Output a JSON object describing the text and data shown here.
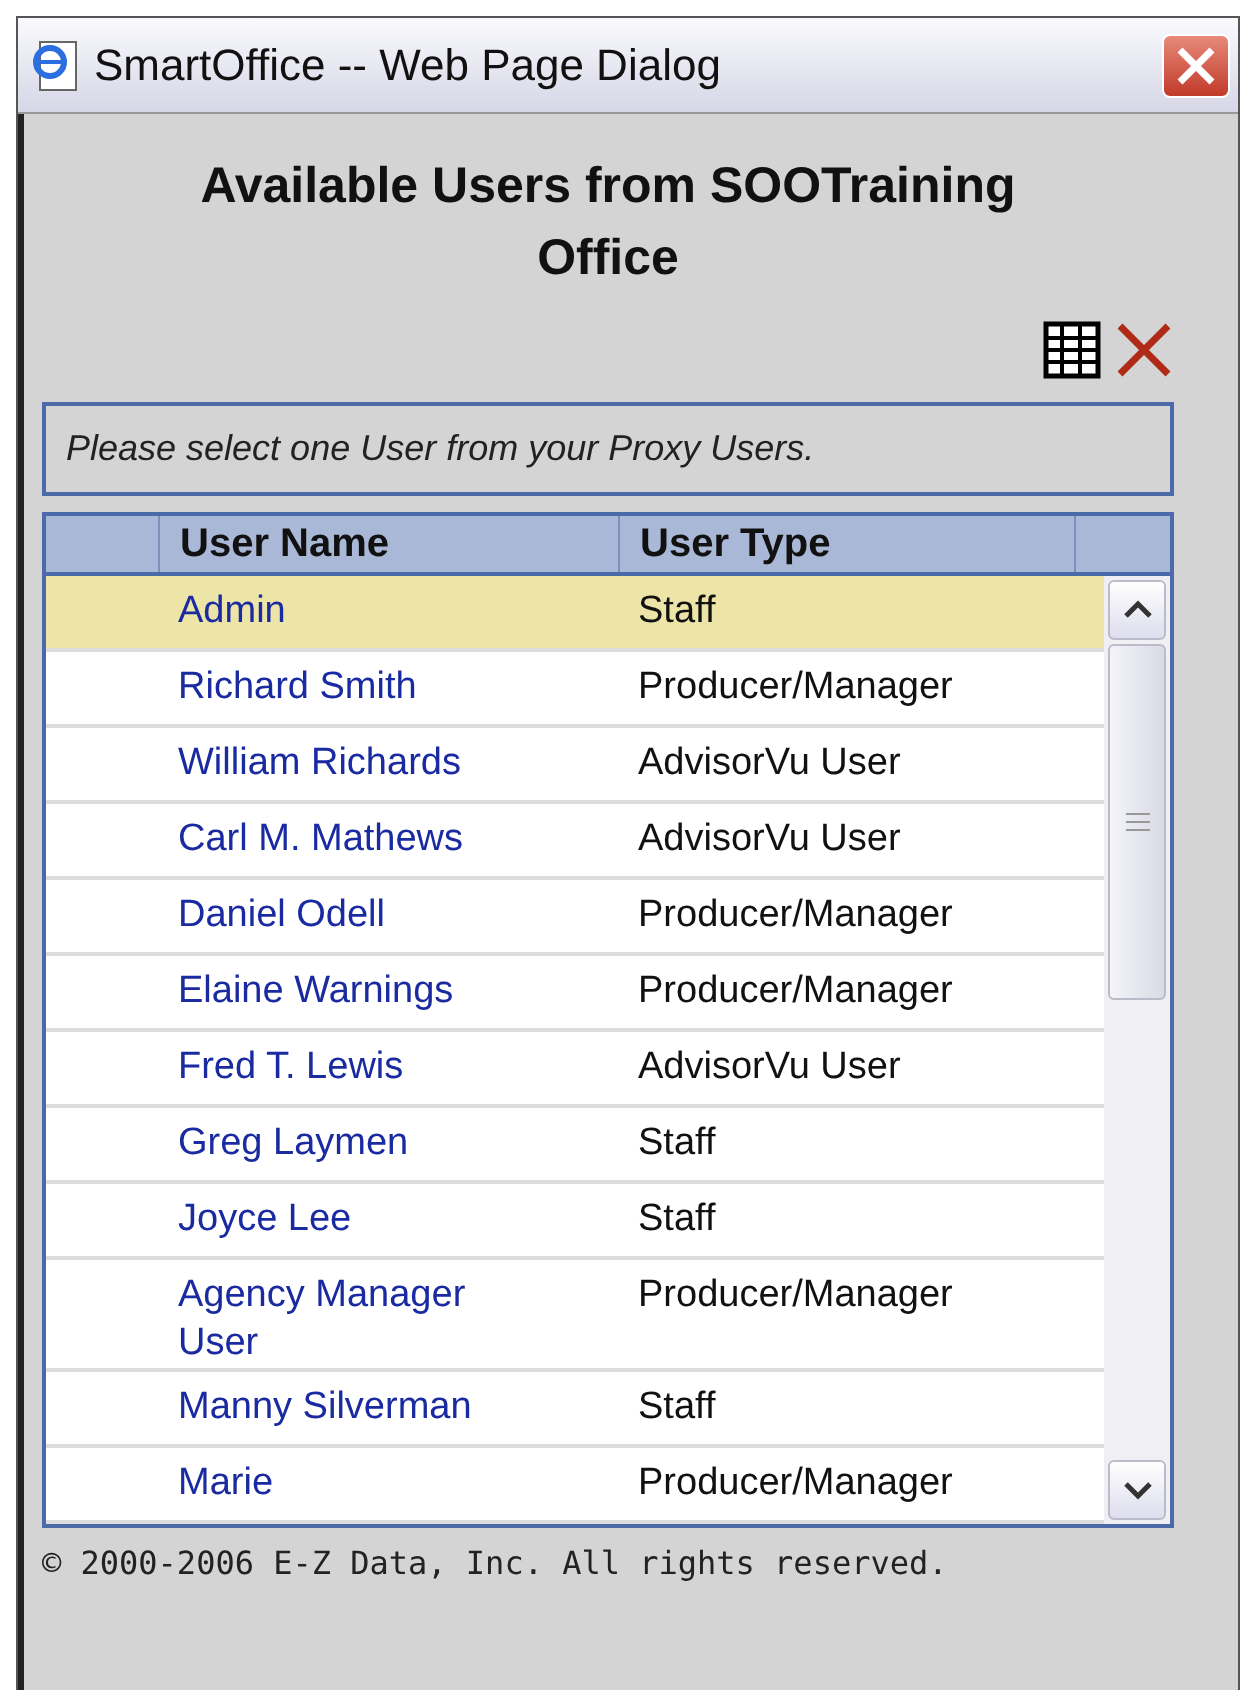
{
  "window": {
    "title": "SmartOffice -- Web Page Dialog"
  },
  "heading": "Available Users from SOOTraining Office",
  "message": "Please select one User from your Proxy Users.",
  "table": {
    "columns": [
      "User Name",
      "User Type"
    ],
    "rows": [
      {
        "name": "Admin",
        "type": "Staff",
        "selected": true
      },
      {
        "name": "Richard Smith",
        "type": "Producer/Manager",
        "selected": false
      },
      {
        "name": "William Richards",
        "type": "AdvisorVu User",
        "selected": false
      },
      {
        "name": "Carl M. Mathews",
        "type": "AdvisorVu User",
        "selected": false
      },
      {
        "name": "Daniel Odell",
        "type": "Producer/Manager",
        "selected": false
      },
      {
        "name": "Elaine Warnings",
        "type": "Producer/Manager",
        "selected": false
      },
      {
        "name": "Fred T. Lewis",
        "type": "AdvisorVu User",
        "selected": false
      },
      {
        "name": "Greg Laymen",
        "type": "Staff",
        "selected": false
      },
      {
        "name": "Joyce Lee",
        "type": "Staff",
        "selected": false
      },
      {
        "name": "Agency Manager User",
        "type": "Producer/Manager",
        "selected": false
      },
      {
        "name": "Manny Silverman",
        "type": "Staff",
        "selected": false
      },
      {
        "name": "Marie",
        "type": "Producer/Manager",
        "selected": false
      }
    ]
  },
  "footer": "© 2000-2006 E-Z Data, Inc. All rights reserved."
}
